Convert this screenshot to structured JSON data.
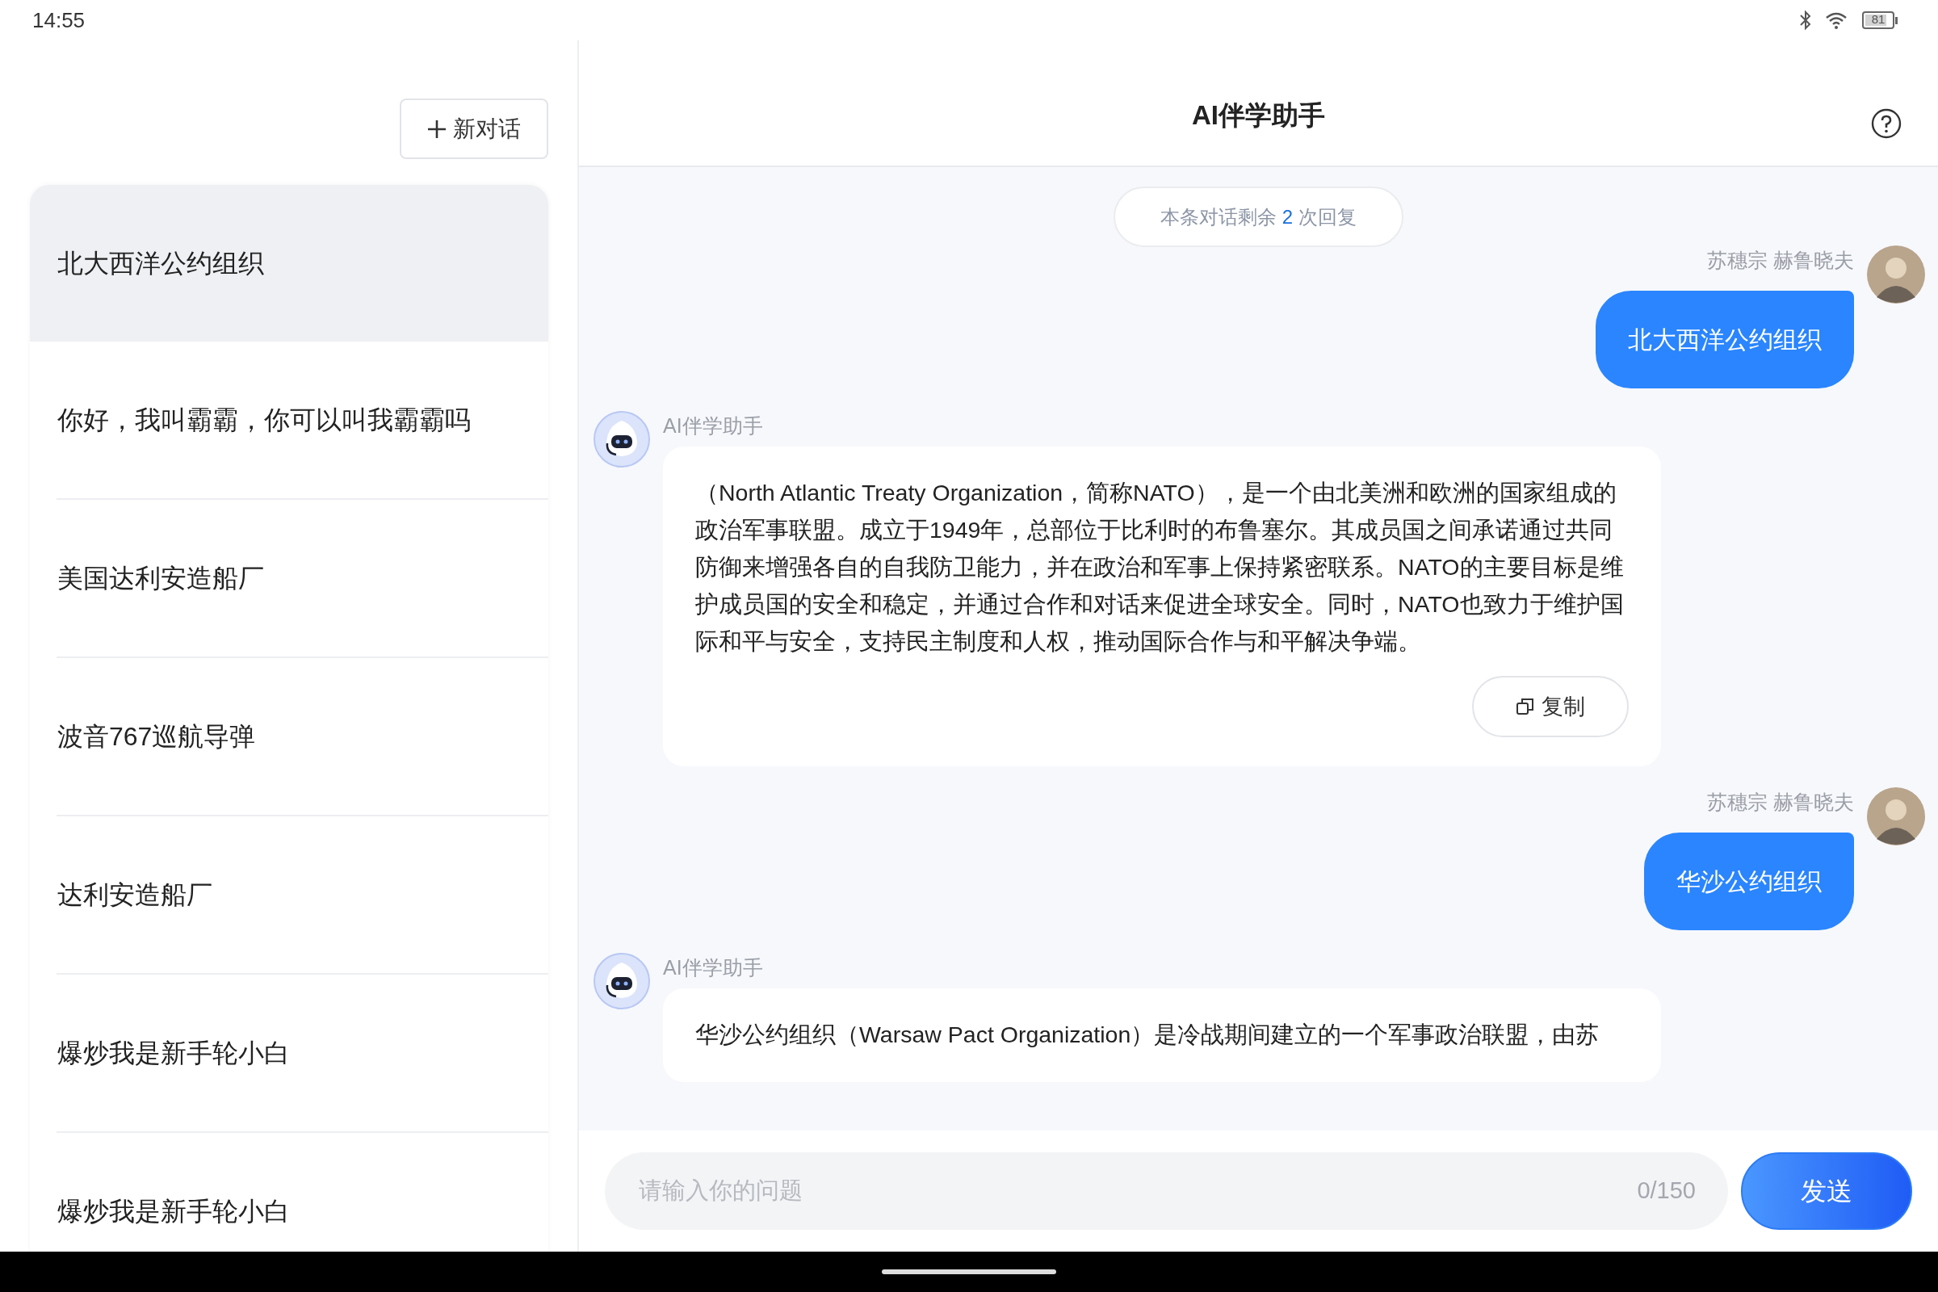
{
  "status_bar": {
    "time": "14:55",
    "battery": {
      "reading": "81",
      "level": 0.81
    }
  },
  "sidebar": {
    "new_chat_button": {
      "label": "新对话"
    },
    "conversations": [
      {
        "title": "北大西洋公约组织",
        "selected": true
      },
      {
        "title": "你好，我叫霸霸，你可以叫我霸霸吗",
        "selected": false
      },
      {
        "title": "美国达利安造船厂",
        "selected": false
      },
      {
        "title": "波音767巡航导弹",
        "selected": false
      },
      {
        "title": "达利安造船厂",
        "selected": false
      },
      {
        "title": "爆炒我是新手轮小白",
        "selected": false
      },
      {
        "title": "爆炒我是新手轮小白",
        "selected": false
      }
    ]
  },
  "header": {
    "title": "AI伴学助手"
  },
  "quota": {
    "prefix": "本条对话剩余",
    "count": "2",
    "suffix": "次回复"
  },
  "messages": [
    {
      "kind": "user",
      "sender": "苏穗宗 赫鲁晓夫",
      "text": "北大西洋公约组织"
    },
    {
      "kind": "assistant",
      "sender": "AI伴学助手",
      "text": "（North Atlantic Treaty Organization，简称NATO），是一个由北美洲和欧洲的国家组成的政治军事联盟。成立于1949年，总部位于比利时的布鲁塞尔。其成员国之间承诺通过共同防御来增强各自的自我防卫能力，并在政治和军事上保持紧密联系。NATO的主要目标是维护成员国的安全和稳定，并通过合作和对话来促进全球安全。同时，NATO也致力于维护国际和平与安全，支持民主制度和人权，推动国际合作与和平解决争端。",
      "copy_label": "复制"
    },
    {
      "kind": "user",
      "sender": "苏穗宗 赫鲁晓夫",
      "text": "华沙公约组织"
    },
    {
      "kind": "assistant",
      "sender": "AI伴学助手",
      "text": "华沙公约组织（Warsaw Pact Organization）是冷战期间建立的一个军事政治联盟，由苏"
    }
  ],
  "composer": {
    "placeholder": "请输入你的问题",
    "counter": "0/150",
    "send_label": "发送"
  }
}
